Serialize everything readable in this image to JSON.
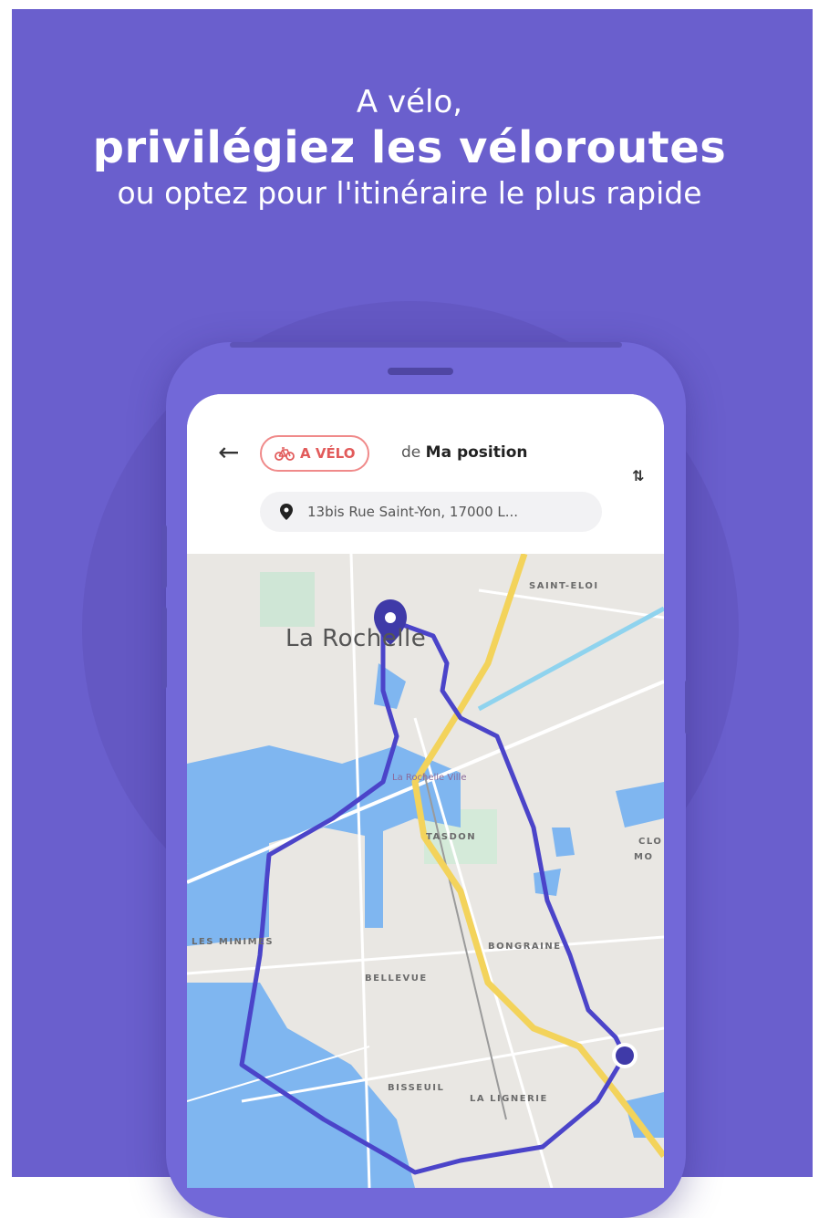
{
  "headline": {
    "line1": "A vélo,",
    "line2": "privilégiez les véloroutes",
    "line3": "ou optez pour l'itinéraire le plus rapide"
  },
  "colors": {
    "background": "#6a5fcd",
    "route": "#4b44c9",
    "mode_accent": "#e25b5b",
    "water": "#7fb6f0",
    "highway": "#f3d35b"
  },
  "topbar": {
    "back_icon": "arrow-left-icon",
    "mode_label": "A VÉLO",
    "mode_icon": "bicycle-icon",
    "from_prefix": "de",
    "from_value": "Ma position",
    "swap_icon": "swap-vertical-icon",
    "destination_icon": "location-pin-icon",
    "destination_value": "13bis Rue Saint-Yon, 17000 L..."
  },
  "map": {
    "city": "La Rochelle",
    "places": {
      "saint_eloi": "SAINT-ELOI",
      "station": "La Rochelle Ville",
      "tasdon": "TASDON",
      "clos": "CLO",
      "mou": "MO",
      "minimes": "LES MINIMES",
      "bellevue": "BELLEVUE",
      "bongraine": "BONGRAINE",
      "bisseuil": "BISSEUIL",
      "lignerie": "LA LIGNERIE"
    }
  }
}
